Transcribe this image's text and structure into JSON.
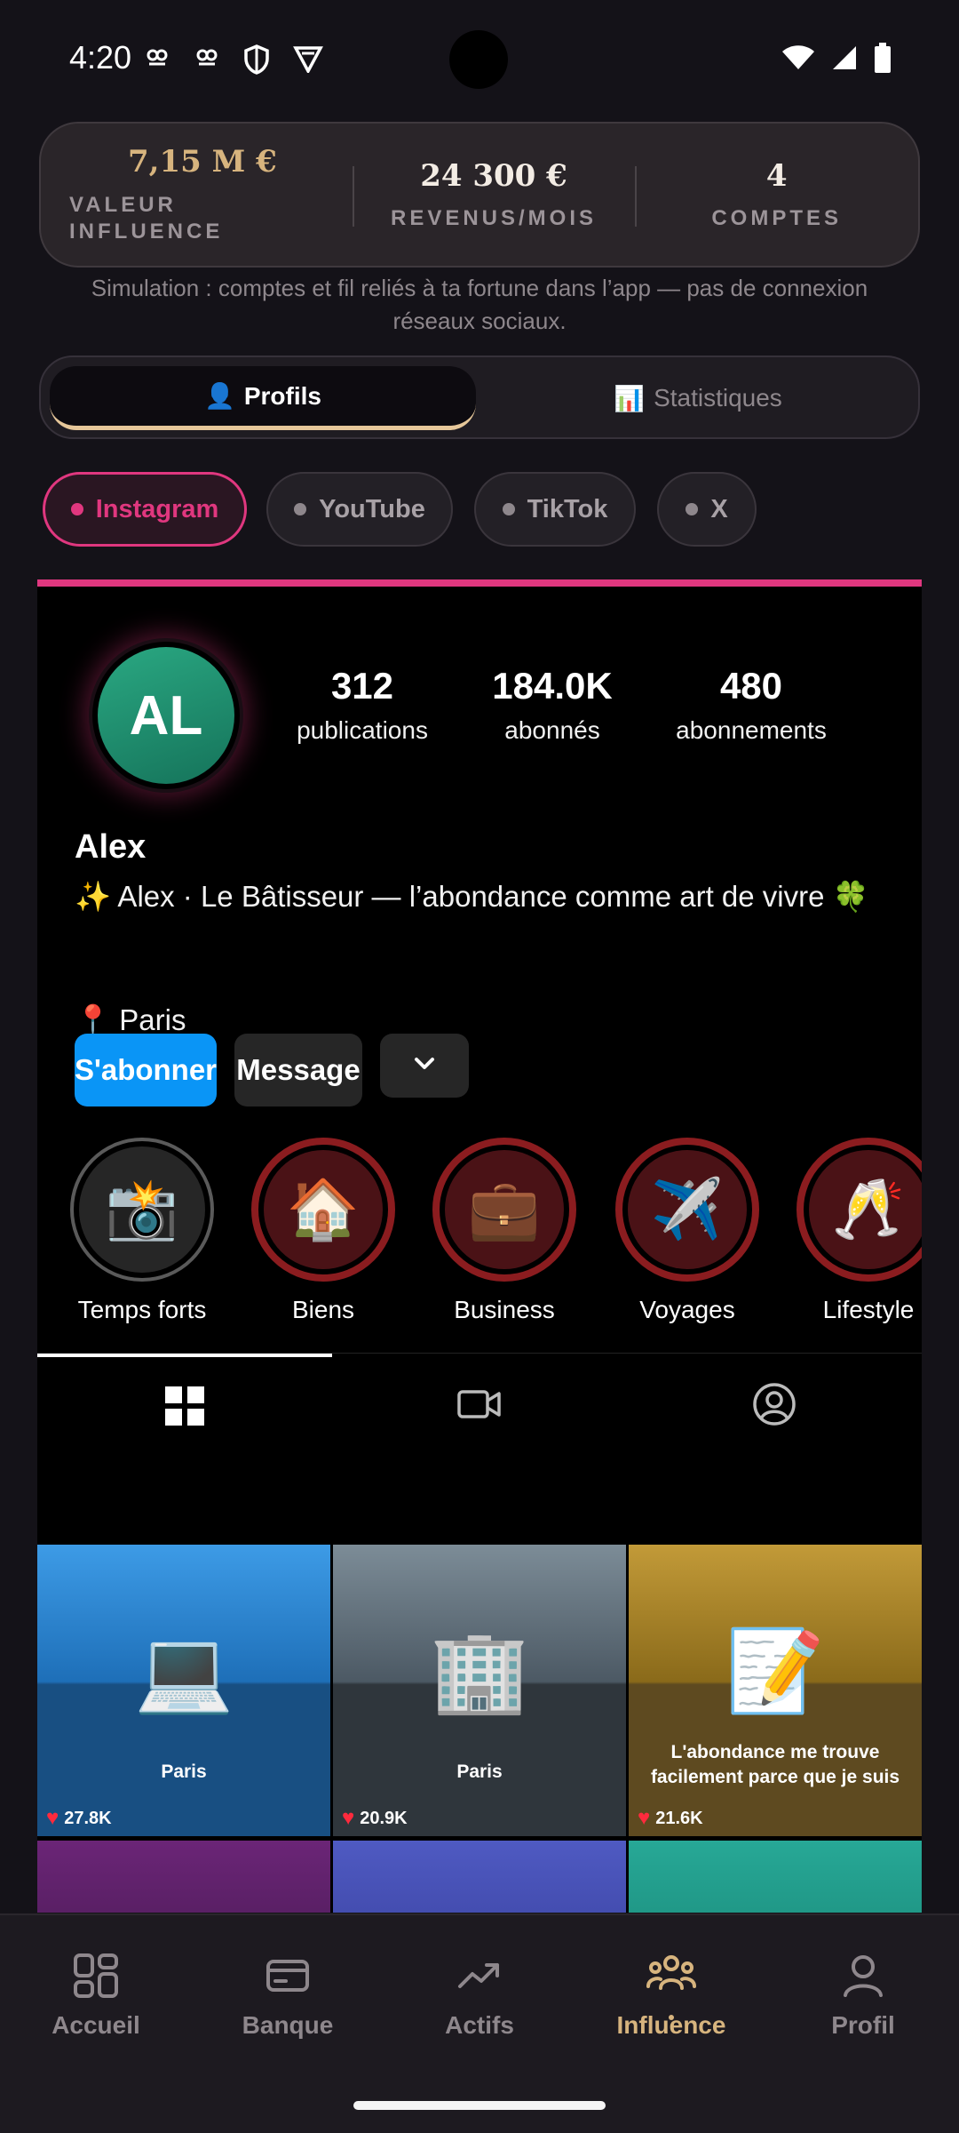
{
  "status_bar": {
    "time": "4:20"
  },
  "summary": {
    "items": [
      {
        "value": "7,15 M €",
        "label": "VALEUR INFLUENCE"
      },
      {
        "value": "24 300 €",
        "label": "REVENUS/MOIS"
      },
      {
        "value": "4",
        "label": "COMPTES"
      }
    ],
    "note": "Simulation : comptes et fil reliés à ta fortune dans l’app — pas de connexion réseaux sociaux."
  },
  "tabs": {
    "profiles": {
      "icon": "👤",
      "label": "Profils"
    },
    "stats": {
      "icon": "📊",
      "label": "Statistiques"
    }
  },
  "platforms": [
    "Instagram",
    "YouTube",
    "TikTok",
    "X"
  ],
  "profile": {
    "initials": "AL",
    "stats": [
      {
        "value": "312",
        "label": "publications"
      },
      {
        "value": "184.0K",
        "label": "abonnés"
      },
      {
        "value": "480",
        "label": "abonnements"
      }
    ],
    "name": "Alex",
    "bio": "✨ Alex · Le Bâtisseur — l’abondance comme art de vivre 🍀",
    "location": "📍 Paris",
    "follow_label": "S'abonner",
    "message_label": "Message"
  },
  "highlights": [
    {
      "emoji": "📸",
      "label": "Temps forts"
    },
    {
      "emoji": "🏠",
      "label": "Biens"
    },
    {
      "emoji": "💼",
      "label": "Business"
    },
    {
      "emoji": "✈️",
      "label": "Voyages"
    },
    {
      "emoji": "🥂",
      "label": "Lifestyle"
    }
  ],
  "posts": [
    {
      "emoji": "💻",
      "caption": "Paris",
      "likes": "27.8K",
      "colors": [
        "#3d9be6",
        "#1e6fb8",
        "#184f82"
      ]
    },
    {
      "emoji": "🏢",
      "caption": "Paris",
      "likes": "20.9K",
      "colors": [
        "#7c8c97",
        "#4c5964",
        "#2f363c"
      ]
    },
    {
      "emoji": "📝",
      "caption": "L'abondance me trouve facilement parce que je suis prê…",
      "likes": "21.6K",
      "colors": [
        "#c29a38",
        "#8a6a1a",
        "#5e4a20"
      ]
    },
    {
      "emoji": "🏰",
      "caption": "",
      "likes": "",
      "colors": [
        "#6b2577",
        "#4a1b55",
        "#3a1444"
      ]
    },
    {
      "emoji": "✨",
      "caption": "",
      "likes": "",
      "colors": [
        "#4f5ac2",
        "#3a42a0",
        "#2c3380"
      ]
    },
    {
      "emoji": "💫",
      "caption": "",
      "likes": "",
      "colors": [
        "#27a896",
        "#1a8a7a",
        "#126a5c"
      ]
    }
  ],
  "nav": [
    {
      "label": "Accueil",
      "icon": "grid-icon"
    },
    {
      "label": "Banque",
      "icon": "wallet-icon"
    },
    {
      "label": "Actifs",
      "icon": "trend-icon"
    },
    {
      "label": "Influence",
      "icon": "people-icon",
      "active": true
    },
    {
      "label": "Profil",
      "icon": "person-icon"
    }
  ],
  "colors": {
    "accent": "#d7b47e",
    "instagram": "#e0377f",
    "follow": "#0a95f6"
  }
}
